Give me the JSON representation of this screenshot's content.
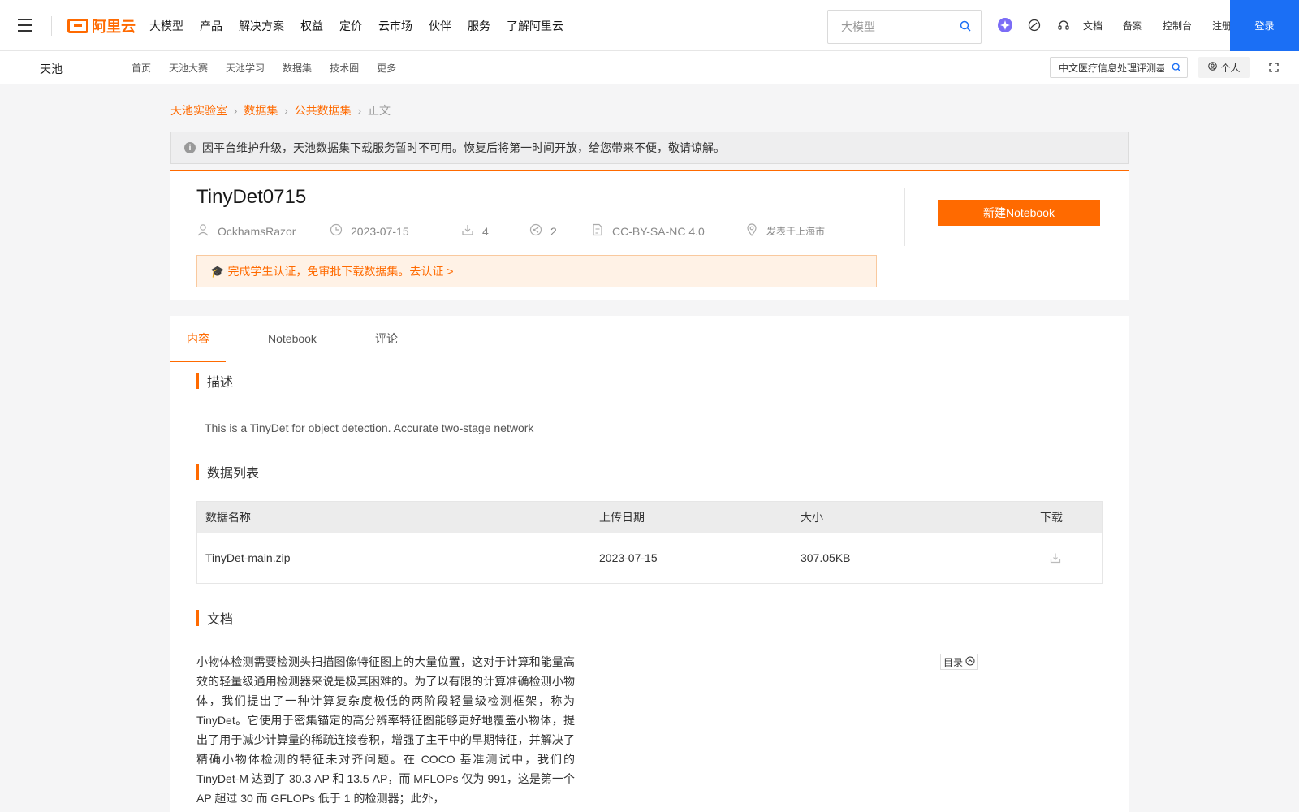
{
  "topnav": {
    "menu": [
      "大模型",
      "产品",
      "解决方案",
      "权益",
      "定价",
      "云市场",
      "伙伴",
      "服务",
      "了解阿里云"
    ],
    "logo_text": "阿里云",
    "search_placeholder": "大模型",
    "links": [
      "文档",
      "备案",
      "控制台",
      "注册"
    ],
    "login": "登录",
    "icons": [
      "ai-assistant-icon",
      "speed-icon",
      "headset-icon"
    ]
  },
  "subnav": {
    "brand": "天池",
    "menu": [
      "首页",
      "天池大赛",
      "天池学习",
      "数据集",
      "技术圈",
      "更多"
    ],
    "search_value": "中文医疗信息处理评测基",
    "personal": "个人"
  },
  "breadcrumb": [
    "天池实验室",
    "数据集",
    "公共数据集",
    "正文"
  ],
  "notice": "因平台维护升级，天池数据集下载服务暂时不可用。恢复后将第一时间开放，给您带来不便，敬请谅解。",
  "dataset": {
    "title": "TinyDet0715",
    "author": "OckhamsRazor",
    "date": "2023-07-15",
    "downloads": "4",
    "shares": "2",
    "license": "CC-BY-SA-NC 4.0",
    "location": "发表于上海市",
    "new_notebook": "新建Notebook",
    "cert_text": "完成学生认证，免审批下载数据集。去认证 >"
  },
  "tabs": [
    "内容",
    "Notebook",
    "评论"
  ],
  "sections": {
    "description_title": "描述",
    "description": "This is a TinyDet for object detection. Accurate two-stage network",
    "datalist_title": "数据列表",
    "doc_title": "文档",
    "toc": "目录"
  },
  "table": {
    "headers": [
      "数据名称",
      "上传日期",
      "大小",
      "下载"
    ],
    "rows": [
      {
        "name": "TinyDet-main.zip",
        "date": "2023-07-15",
        "size": "307.05KB"
      }
    ]
  },
  "doc_text": "小物体检测需要检测头扫描图像特征图上的大量位置，这对于计算和能量高效的轻量级通用检测器来说是极其困难的。为了以有限的计算准确检测小物体，我们提出了一种计算复杂度极低的两阶段轻量级检测框架，称为 TinyDet。它使用于密集锚定的高分辨率特征图能够更好地覆盖小物体，提出了用于减少计算量的稀疏连接卷积，增强了主干中的早期特征，并解决了精确小物体检测的特征未对齐问题。在 COCO 基准测试中，我们的 TinyDet-M 达到了 30.3 AP 和 13.5 AP，而 MFLOPs 仅为 991，这是第一个 AP 超过 30 而 GFLOPs 低于 1 的检测器；此外，"
}
